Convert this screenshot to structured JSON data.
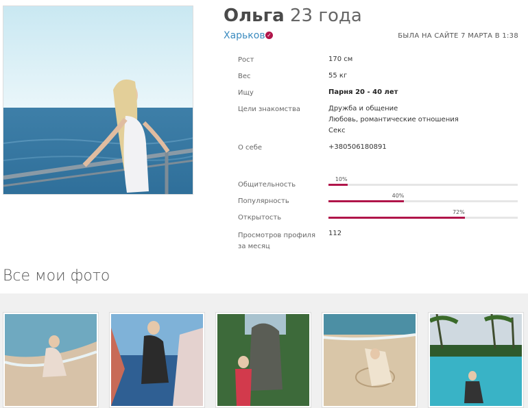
{
  "profile": {
    "name": "Ольга",
    "age": "23 года",
    "city": "Харьков",
    "verified_icon": "check-badge-icon",
    "last_seen": "БЫЛА НА САЙТЕ 7 МАРТА В 1:38"
  },
  "info": [
    {
      "label": "Рост",
      "value": [
        "170 см"
      ]
    },
    {
      "label": "Вес",
      "value": [
        "55 кг"
      ]
    },
    {
      "label": "Ищу",
      "value": [
        "Парня 20 - 40 лет"
      ]
    },
    {
      "label": "Цели знакомства",
      "value": [
        "Дружба и общение",
        "Любовь, романтические отношения",
        "Секс"
      ]
    },
    {
      "label": "О себе",
      "value": [
        "+380506180891"
      ]
    }
  ],
  "stats": [
    {
      "label": "Общительность",
      "percent": 10,
      "text": "10%"
    },
    {
      "label": "Популярность",
      "percent": 40,
      "text": "40%"
    },
    {
      "label": "Открытость",
      "percent": 72,
      "text": "72%"
    }
  ],
  "views": {
    "label_line1": "Просмотров профиля",
    "label_line2": "за месяц",
    "value": "112"
  },
  "gallery": {
    "title": "Все мои фото"
  },
  "colors": {
    "accent": "#b0154a",
    "link": "#3b8bbf"
  }
}
